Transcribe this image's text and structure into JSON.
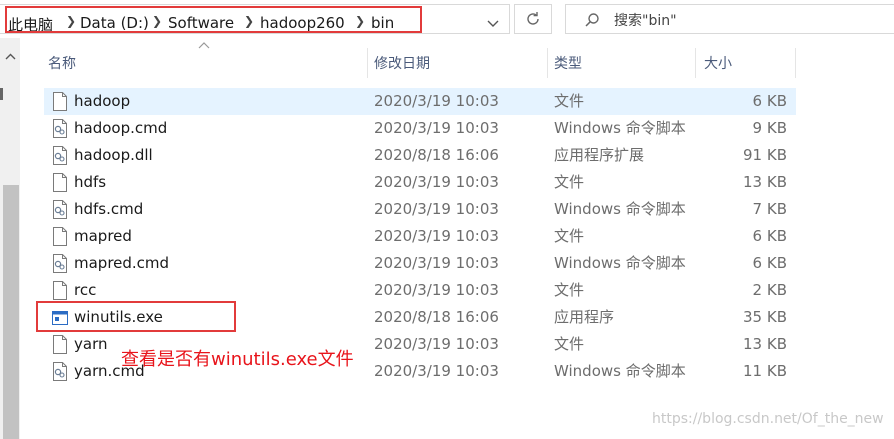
{
  "address_bar": {
    "crumbs": [
      "此电脑",
      "Data (D:)",
      "Software",
      "hadoop260",
      "bin"
    ],
    "search_placeholder": "搜索\"bin\""
  },
  "columns": {
    "name": "名称",
    "date": "修改日期",
    "type": "类型",
    "size": "大小"
  },
  "files": [
    {
      "name": "hadoop",
      "date": "2020/3/19 10:03",
      "type": "文件",
      "size": "6 KB",
      "icon": "file-icon",
      "selected": true
    },
    {
      "name": "hadoop.cmd",
      "date": "2020/3/19 10:03",
      "type": "Windows 命令脚本",
      "size": "9 KB",
      "icon": "cmd-file-icon"
    },
    {
      "name": "hadoop.dll",
      "date": "2020/8/18 16:06",
      "type": "应用程序扩展",
      "size": "91 KB",
      "icon": "dll-file-icon"
    },
    {
      "name": "hdfs",
      "date": "2020/3/19 10:03",
      "type": "文件",
      "size": "13 KB",
      "icon": "file-icon"
    },
    {
      "name": "hdfs.cmd",
      "date": "2020/3/19 10:03",
      "type": "Windows 命令脚本",
      "size": "7 KB",
      "icon": "cmd-file-icon"
    },
    {
      "name": "mapred",
      "date": "2020/3/19 10:03",
      "type": "文件",
      "size": "6 KB",
      "icon": "file-icon"
    },
    {
      "name": "mapred.cmd",
      "date": "2020/3/19 10:03",
      "type": "Windows 命令脚本",
      "size": "6 KB",
      "icon": "cmd-file-icon"
    },
    {
      "name": "rcc",
      "date": "2020/3/19 10:03",
      "type": "文件",
      "size": "2 KB",
      "icon": "file-icon"
    },
    {
      "name": "winutils.exe",
      "date": "2020/8/18 16:06",
      "type": "应用程序",
      "size": "35 KB",
      "icon": "exe-file-icon"
    },
    {
      "name": "yarn",
      "date": "2020/3/19 10:03",
      "type": "文件",
      "size": "13 KB",
      "icon": "file-icon"
    },
    {
      "name": "yarn.cmd",
      "date": "2020/3/19 10:03",
      "type": "Windows 命令脚本",
      "size": "11 KB",
      "icon": "cmd-file-icon"
    }
  ],
  "annotation": "查看是否有winutils.exe文件",
  "watermark": "https://blog.csdn.net/Of_the_new",
  "colors": {
    "annotation_red": "#e8141b",
    "selection": "#e5f3ff"
  }
}
